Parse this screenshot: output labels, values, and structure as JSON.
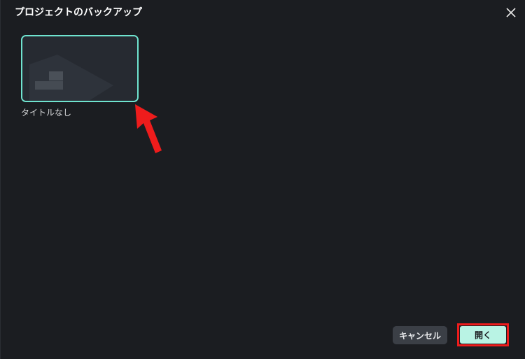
{
  "dialog": {
    "title": "プロジェクトのバックアップ",
    "close_icon": "close-icon"
  },
  "projects": [
    {
      "name": "タイトルなし",
      "selected": true
    }
  ],
  "footer": {
    "cancel_label": "キャンセル",
    "open_label": "開く"
  },
  "colors": {
    "background": "#1b1d21",
    "selection_border": "#6fe3cf",
    "primary_button": "#b9f3e4",
    "secondary_button": "#3b3f46",
    "annotation": "#ee1c1c"
  }
}
